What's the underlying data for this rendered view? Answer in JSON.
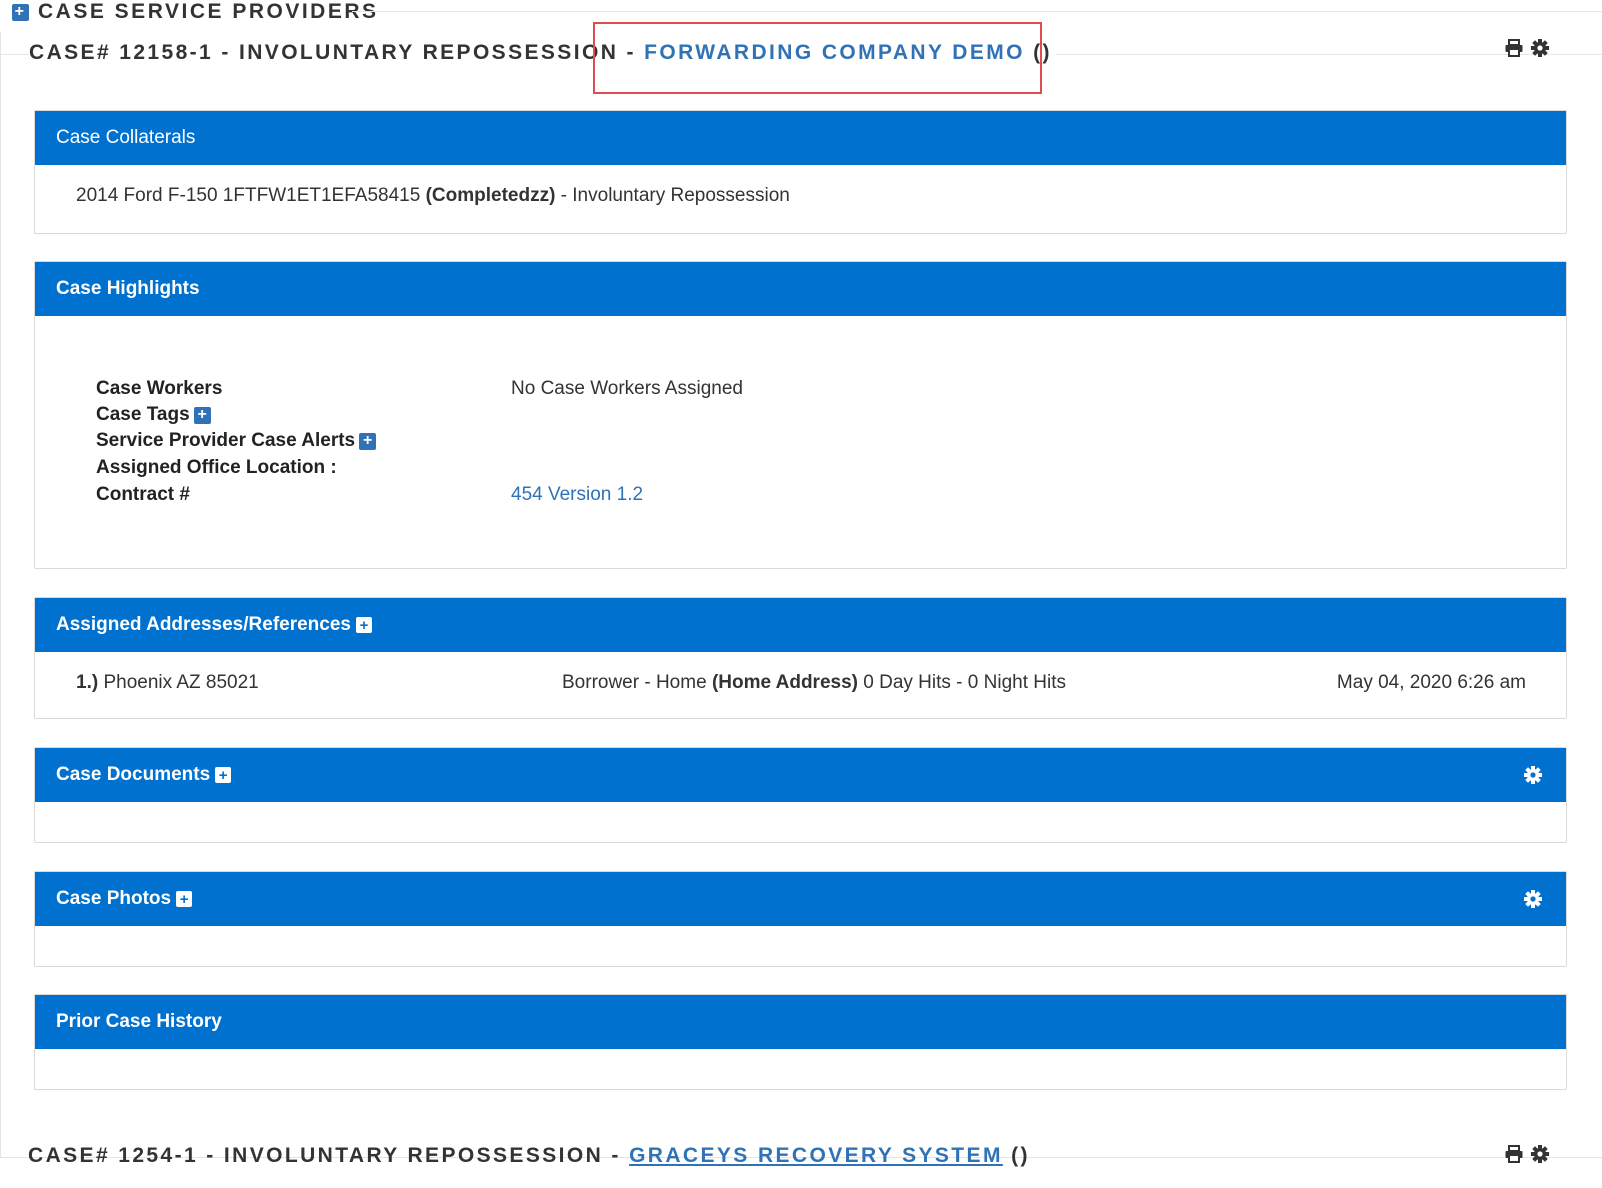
{
  "section": {
    "title": "CASE SERVICE PROVIDERS"
  },
  "case_main": {
    "title_prefix": "CASE# 12158-1 - INVOLUNTARY REPOSSESSION -",
    "provider_link": "FORWARDING COMPANY DEMO",
    "provider_suffix": "()"
  },
  "collaterals": {
    "header": "Case Collaterals",
    "vehicle": "2014 Ford F-150 1FTFW1ET1EFA58415",
    "status": "(Completedzz)",
    "type": "- Involuntary Repossession"
  },
  "highlights": {
    "header": "Case Highlights",
    "rows": [
      {
        "label": "Case Workers",
        "value": "No Case Workers Assigned"
      },
      {
        "label": "Case Tags",
        "value": ""
      },
      {
        "label": "Service Provider Case Alerts",
        "value": ""
      },
      {
        "label": "Assigned Office Location :",
        "value": ""
      },
      {
        "label": "Contract #",
        "value": "454 Version 1.2"
      }
    ]
  },
  "addresses": {
    "header": "Assigned Addresses/References",
    "items": [
      {
        "index": "1.)",
        "location": "Phoenix AZ 85021",
        "role": "Borrower - Home",
        "addr_type": "(Home Address)",
        "hits": "0 Day Hits - 0 Night Hits",
        "date": "May 04, 2020 6:26 am"
      }
    ]
  },
  "documents": {
    "header": "Case Documents"
  },
  "photos": {
    "header": "Case Photos"
  },
  "history": {
    "header": "Prior Case History"
  },
  "case_next": {
    "title_prefix": "CASE# 1254-1 - INVOLUNTARY REPOSSESSION -",
    "provider_link": "GRACEYS RECOVERY SYSTEM",
    "provider_suffix": "()"
  },
  "icons": {
    "section_toggle": "plus-square-icon",
    "print": "print-icon",
    "settings": "gear-icon"
  },
  "colors": {
    "panel_header": "#0071ce",
    "link": "#2f73b6",
    "highlight_border": "#e04c52"
  }
}
